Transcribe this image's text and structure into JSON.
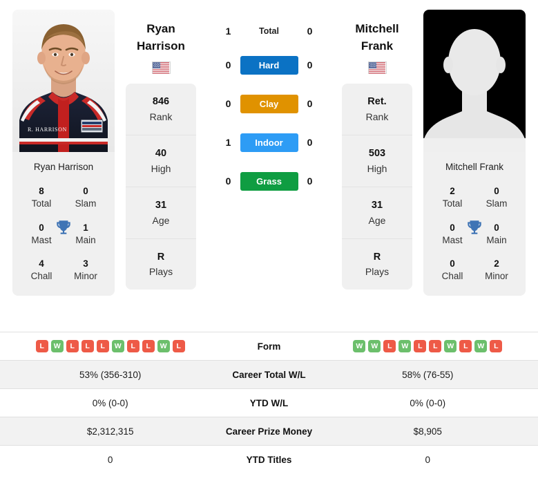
{
  "colors": {
    "hard": "#0b72c4",
    "clay": "#e09200",
    "indoor": "#2d9cf5",
    "grass": "#0f9d42",
    "win": "#6cbf6c",
    "loss": "#ee5a47",
    "trophy": "#3f74b5",
    "card_bg": "#f0f0f0",
    "row_alt_bg": "#f2f2f2"
  },
  "players": {
    "left": {
      "first_name": "Ryan",
      "last_name": "Harrison",
      "full_name": "Ryan Harrison",
      "country_flag": "us-flag-icon",
      "photo": "player-photo-ryan-harrison",
      "stats": [
        {
          "value": "846",
          "label": "Rank"
        },
        {
          "value": "40",
          "label": "High"
        },
        {
          "value": "31",
          "label": "Age"
        },
        {
          "value": "R",
          "label": "Plays"
        }
      ],
      "titles": [
        {
          "value": "8",
          "label": "Total"
        },
        {
          "value": "0",
          "label": "Slam"
        },
        {
          "value": "0",
          "label": "Mast"
        },
        {
          "value": "1",
          "label": "Main"
        },
        {
          "value": "4",
          "label": "Chall"
        },
        {
          "value": "3",
          "label": "Minor"
        }
      ],
      "form": [
        "L",
        "W",
        "L",
        "L",
        "L",
        "W",
        "L",
        "L",
        "W",
        "L"
      ],
      "career_total_wl": "53% (356-310)",
      "ytd_wl": "0% (0-0)",
      "career_prize_money": "$2,312,315",
      "ytd_titles": "0"
    },
    "right": {
      "first_name": "Mitchell",
      "last_name": "Frank",
      "full_name": "Mitchell Frank",
      "country_flag": "us-flag-icon",
      "photo": "player-photo-placeholder-silhouette",
      "stats": [
        {
          "value": "Ret.",
          "label": "Rank"
        },
        {
          "value": "503",
          "label": "High"
        },
        {
          "value": "31",
          "label": "Age"
        },
        {
          "value": "R",
          "label": "Plays"
        }
      ],
      "titles": [
        {
          "value": "2",
          "label": "Total"
        },
        {
          "value": "0",
          "label": "Slam"
        },
        {
          "value": "0",
          "label": "Mast"
        },
        {
          "value": "0",
          "label": "Main"
        },
        {
          "value": "0",
          "label": "Chall"
        },
        {
          "value": "2",
          "label": "Minor"
        }
      ],
      "form": [
        "W",
        "W",
        "L",
        "W",
        "L",
        "L",
        "W",
        "L",
        "W",
        "L"
      ],
      "career_total_wl": "58% (76-55)",
      "ytd_wl": "0% (0-0)",
      "career_prize_money": "$8,905",
      "ytd_titles": "0"
    }
  },
  "surface_comparison": [
    {
      "label": "Total",
      "left": "1",
      "right": "0",
      "style": "plain"
    },
    {
      "label": "Hard",
      "left": "0",
      "right": "0",
      "style": "badge",
      "color": "#0b72c4"
    },
    {
      "label": "Clay",
      "left": "0",
      "right": "0",
      "style": "badge",
      "color": "#e09200"
    },
    {
      "label": "Indoor",
      "left": "1",
      "right": "0",
      "style": "badge",
      "color": "#2d9cf5"
    },
    {
      "label": "Grass",
      "left": "0",
      "right": "0",
      "style": "badge",
      "color": "#0f9d42"
    }
  ],
  "stats_table": {
    "rows": [
      {
        "label": "Form",
        "type": "form",
        "alt": false
      },
      {
        "label": "Career Total W/L",
        "type": "text",
        "alt": true,
        "left": "53% (356-310)",
        "right": "58% (76-55)"
      },
      {
        "label": "YTD W/L",
        "type": "text",
        "alt": false,
        "left": "0% (0-0)",
        "right": "0% (0-0)"
      },
      {
        "label": "Career Prize Money",
        "type": "text",
        "alt": true,
        "left": "$2,312,315",
        "right": "$8,905"
      },
      {
        "label": "YTD Titles",
        "type": "text",
        "alt": false,
        "left": "0",
        "right": "0"
      }
    ]
  }
}
